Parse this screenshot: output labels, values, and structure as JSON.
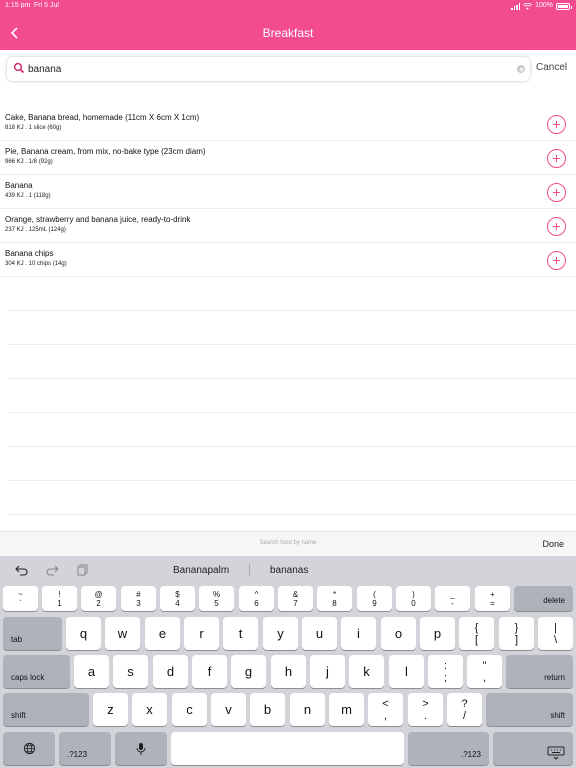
{
  "status": {
    "time": "1:15 pm",
    "date": "Fri 5 Jul",
    "battery": "100%"
  },
  "nav": {
    "title": "Breakfast"
  },
  "search": {
    "value": "banana",
    "cancel_label": "Cancel"
  },
  "results": [
    {
      "name": "Cake, Banana bread, homemade (11cm X 6cm X 1cm)",
      "meta": "818 KJ . 1 slice (60g)"
    },
    {
      "name": "Pie, Banana cream, from mix, no-bake type (23cm diam)",
      "meta": "966 KJ . 1/8 (92g)"
    },
    {
      "name": "Banana",
      "meta": "439 KJ . 1 (118g)"
    },
    {
      "name": "Orange, strawberry and banana juice, ready-to-drink",
      "meta": "237 KJ . 125mL (124g)"
    },
    {
      "name": "Banana chips",
      "meta": "304 KJ . 10 chips (14g)"
    }
  ],
  "accessory": {
    "hint": "Search food by name",
    "done_label": "Done"
  },
  "keyboard": {
    "suggestions": [
      "Bananapalm",
      "bananas"
    ],
    "numrow": [
      {
        "top": "~",
        "bottom": "`"
      },
      {
        "top": "!",
        "bottom": "1"
      },
      {
        "top": "@",
        "bottom": "2"
      },
      {
        "top": "#",
        "bottom": "3"
      },
      {
        "top": "$",
        "bottom": "4"
      },
      {
        "top": "%",
        "bottom": "5"
      },
      {
        "top": "^",
        "bottom": "6"
      },
      {
        "top": "&",
        "bottom": "7"
      },
      {
        "top": "*",
        "bottom": "8"
      },
      {
        "top": "(",
        "bottom": "9"
      },
      {
        "top": ")",
        "bottom": "0"
      },
      {
        "top": "_",
        "bottom": "-"
      },
      {
        "top": "+",
        "bottom": "="
      }
    ],
    "delete_label": "delete",
    "tab_label": "tab",
    "row1": [
      "q",
      "w",
      "e",
      "r",
      "t",
      "y",
      "u",
      "i",
      "o",
      "p"
    ],
    "row1_extra": [
      {
        "top": "{",
        "bottom": "["
      },
      {
        "top": "}",
        "bottom": "]"
      },
      {
        "top": "|",
        "bottom": "\\"
      }
    ],
    "caps_label": "caps lock",
    "row2": [
      "a",
      "s",
      "d",
      "f",
      "g",
      "h",
      "j",
      "k",
      "l"
    ],
    "row2_extra": [
      {
        "top": ":",
        "bottom": ";"
      },
      {
        "top": "\"",
        "bottom": ","
      }
    ],
    "return_label": "return",
    "shift_label": "shift",
    "row3": [
      "z",
      "x",
      "c",
      "v",
      "b",
      "n",
      "m"
    ],
    "row3_extra": [
      {
        "top": "<",
        "bottom": ","
      },
      {
        "top": ">",
        "bottom": "."
      },
      {
        "top": "?",
        "bottom": "/"
      }
    ],
    "num_label": ".?123"
  },
  "colors": {
    "accent": "#f24b8f",
    "keyboard_bg": "#d2d4d9"
  }
}
